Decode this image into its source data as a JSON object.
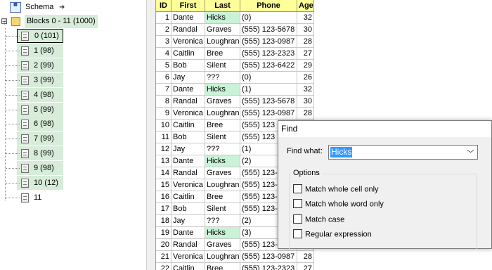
{
  "tree": {
    "schema": {
      "label": "Schema",
      "arrow": "➜"
    },
    "root": {
      "label": "Blocks 0 - 11  (1000)",
      "toggle": "⊟"
    },
    "blocks": [
      {
        "label": "0  (101)",
        "selected": true
      },
      {
        "label": "1  (98)"
      },
      {
        "label": "2  (99)"
      },
      {
        "label": "3  (99)"
      },
      {
        "label": "4  (98)"
      },
      {
        "label": "5  (99)"
      },
      {
        "label": "6  (98)"
      },
      {
        "label": "7  (99)"
      },
      {
        "label": "8  (99)"
      },
      {
        "label": "9  (98)"
      },
      {
        "label": "10  (12)"
      },
      {
        "label": "11",
        "plain": true
      }
    ]
  },
  "grid": {
    "headers": {
      "id": "ID",
      "first": "First",
      "last": "Last",
      "phone": "Phone",
      "age": "Age"
    },
    "rows": [
      {
        "id": "1",
        "first": "Dante",
        "last": "Hicks",
        "phone": "(0)",
        "age": "32",
        "hit": true
      },
      {
        "id": "2",
        "first": "Randal",
        "last": "Graves",
        "phone": "(555) 123-5678",
        "age": "30"
      },
      {
        "id": "3",
        "first": "Veronica",
        "last": "Loughran",
        "phone": "(555) 123-0987",
        "age": "28"
      },
      {
        "id": "4",
        "first": "Caitlin",
        "last": "Bree",
        "phone": "(555) 123-2323",
        "age": "27"
      },
      {
        "id": "5",
        "first": "Bob",
        "last": "Silent",
        "phone": "(555) 123-6422",
        "age": "29"
      },
      {
        "id": "6",
        "first": "Jay",
        "last": "???",
        "phone": "(0)",
        "age": "26"
      },
      {
        "id": "7",
        "first": "Dante",
        "last": "Hicks",
        "phone": "(1)",
        "age": "32",
        "hit": true
      },
      {
        "id": "8",
        "first": "Randal",
        "last": "Graves",
        "phone": "(555) 123-5678",
        "age": "30"
      },
      {
        "id": "9",
        "first": "Veronica",
        "last": "Loughran",
        "phone": "(555) 123-0987",
        "age": "28"
      },
      {
        "id": "10",
        "first": "Caitlin",
        "last": "Bree",
        "phone": "(555) 123",
        "age": ""
      },
      {
        "id": "11",
        "first": "Bob",
        "last": "Silent",
        "phone": "(555) 123",
        "age": ""
      },
      {
        "id": "12",
        "first": "Jay",
        "last": "???",
        "phone": "(1)",
        "age": ""
      },
      {
        "id": "13",
        "first": "Dante",
        "last": "Hicks",
        "phone": "(2)",
        "age": "",
        "hit": true
      },
      {
        "id": "14",
        "first": "Randal",
        "last": "Graves",
        "phone": "(555) 123-",
        "age": ""
      },
      {
        "id": "15",
        "first": "Veronica",
        "last": "Loughran",
        "phone": "(555) 123-",
        "age": ""
      },
      {
        "id": "16",
        "first": "Caitlin",
        "last": "Bree",
        "phone": "(555) 123-",
        "age": ""
      },
      {
        "id": "17",
        "first": "Bob",
        "last": "Silent",
        "phone": "(555) 123-",
        "age": ""
      },
      {
        "id": "18",
        "first": "Jay",
        "last": "???",
        "phone": "(2)",
        "age": ""
      },
      {
        "id": "19",
        "first": "Dante",
        "last": "Hicks",
        "phone": "(3)",
        "age": "",
        "hit": true
      },
      {
        "id": "20",
        "first": "Randal",
        "last": "Graves",
        "phone": "(555) 123-",
        "age": ""
      },
      {
        "id": "21",
        "first": "Veronica",
        "last": "Loughran",
        "phone": "(555) 123-0987",
        "age": "28"
      },
      {
        "id": "22",
        "first": "Caitlin",
        "last": "Bree",
        "phone": "(555) 123-2323",
        "age": "27"
      }
    ]
  },
  "find": {
    "title": "Find",
    "find_what_label": "Find what:",
    "find_what_value": "Hicks",
    "options_label": "Options",
    "options": [
      {
        "label": "Match whole cell only",
        "checked": false
      },
      {
        "label": "Match whole word only",
        "checked": false
      },
      {
        "label": "Match case",
        "checked": false
      },
      {
        "label": "Regular expression",
        "checked": false
      }
    ]
  },
  "colors": {
    "highlight": "#c9f2d6",
    "tree_highlight": "#d7ecd9",
    "header": "#ffff99",
    "selection": "#3399ff"
  }
}
